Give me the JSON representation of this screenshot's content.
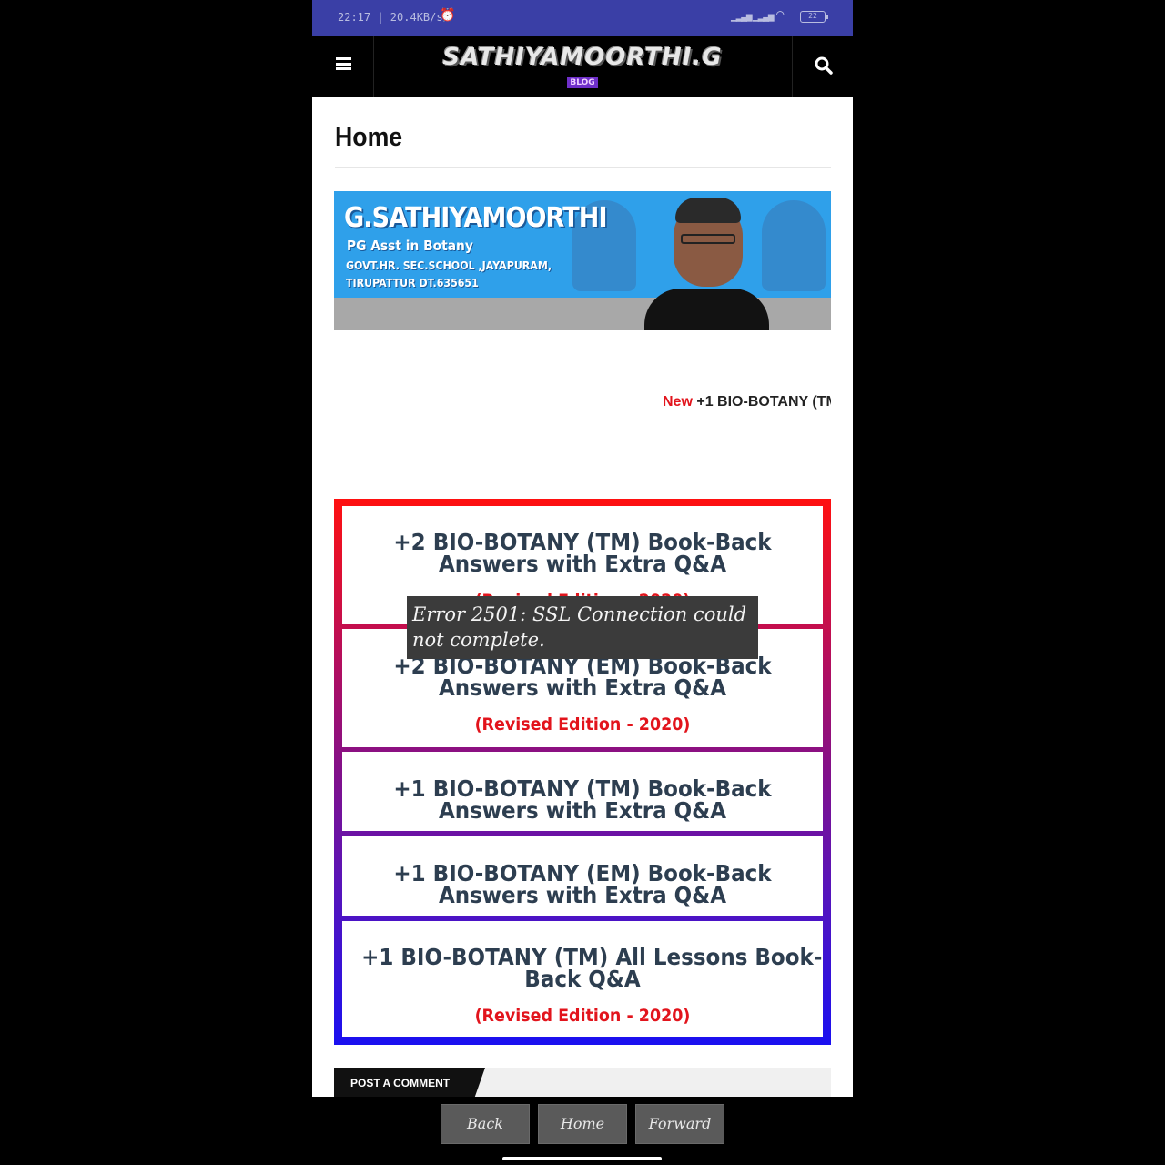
{
  "status_bar": {
    "time": "22:17 | 20.4KB/s",
    "alarm_icon": "alarm-icon",
    "signal_icon": "signal-icon",
    "wifi_icon": "wifi-icon",
    "battery": "22"
  },
  "header": {
    "logo_name": "SATHIYAMOORTHI.G",
    "logo_tag": "BLOG",
    "menu_icon": "hamburger-menu-icon",
    "search_icon": "search-icon"
  },
  "page": {
    "title": "Home"
  },
  "banner": {
    "name": "G.SATHIYAMOORTHI",
    "role": "PG Asst in Botany",
    "school": "GOVT.HR. SEC.SCHOOL ,JAYAPURAM,",
    "district": "TIRUPATTUR DT.635651"
  },
  "ticker": {
    "badge": "New",
    "text": "+1 BIO-BOTANY (TM"
  },
  "links": [
    {
      "line1": "+2 BIO-BOTANY (TM) Book-Back",
      "line2": "Answers with Extra Q&A",
      "edition": "(Revised Edition - 2020)"
    },
    {
      "line1": "+2 BIO-BOTANY (EM) Book-Back",
      "line2": "Answers with Extra Q&A",
      "edition": "(Revised Edition - 2020)"
    },
    {
      "line1": "+1 BIO-BOTANY (TM) Book-Back",
      "line2": "Answers with Extra Q&A",
      "edition": ""
    },
    {
      "line1": "+1 BIO-BOTANY (EM) Book-Back",
      "line2": "Answers with Extra Q&A",
      "edition": ""
    },
    {
      "line1": "+1 BIO-BOTANY (TM) All Lessons Book-",
      "line2": "Back Q&A",
      "edition": "(Revised Edition - 2020)"
    }
  ],
  "comment": {
    "label": "POST A COMMENT"
  },
  "toast": {
    "message": "Error 2501: SSL Connection could not complete."
  },
  "bottom_nav": {
    "back": "Back",
    "home": "Home",
    "forward": "Forward"
  },
  "colors": {
    "status_bar": "#3a3fa6",
    "accent_red": "#e2141c",
    "link_text": "#2d3e50",
    "gradient_top": "#ff1010",
    "gradient_bottom": "#1a10f0",
    "banner_blue": "#2fa0ea"
  }
}
